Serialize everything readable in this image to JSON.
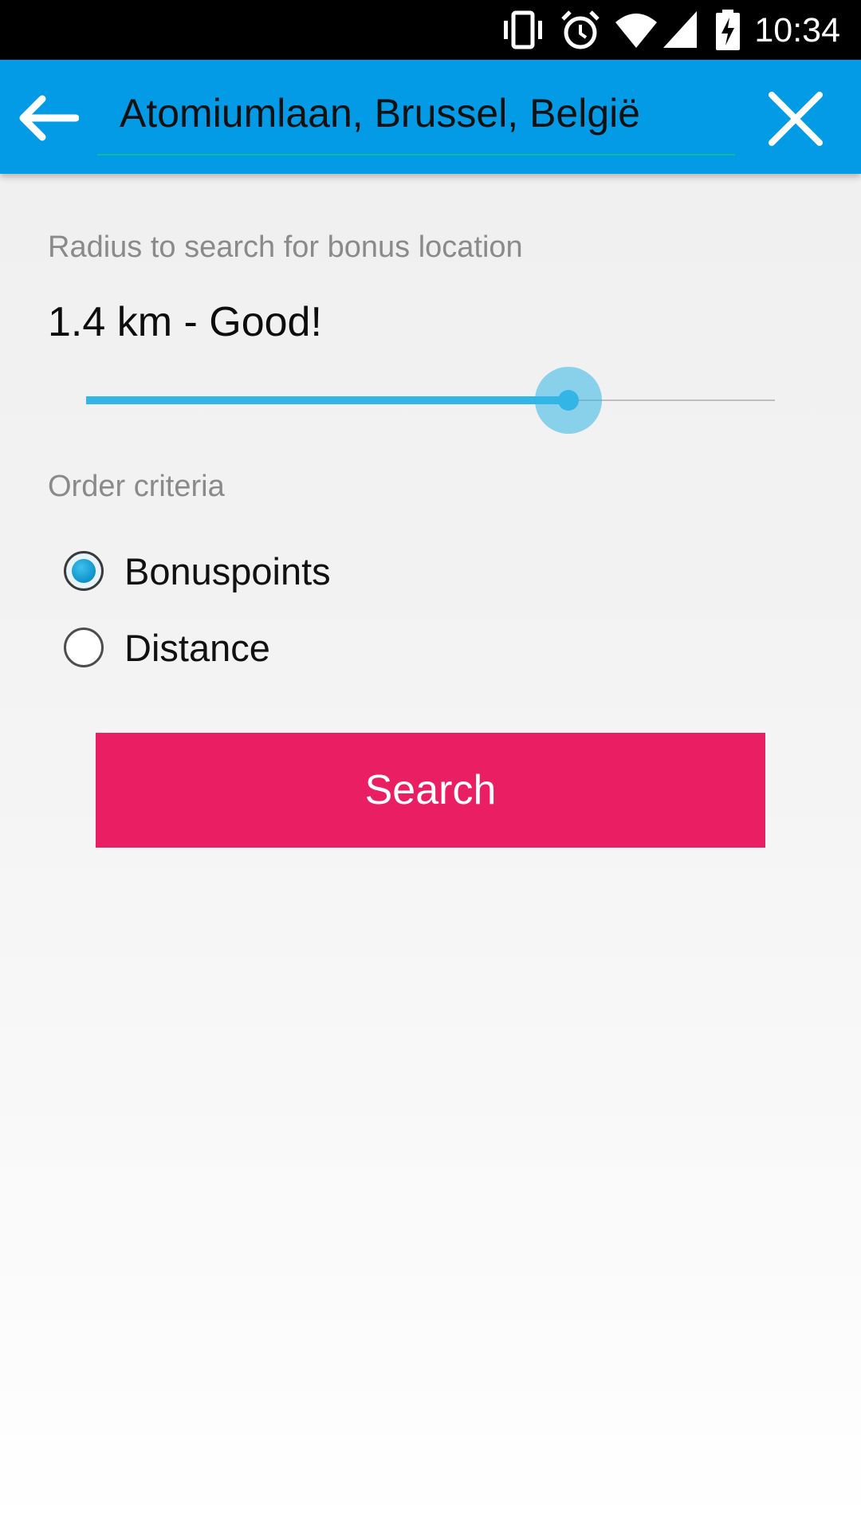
{
  "status_bar": {
    "time": "10:34",
    "icons": [
      "vibrate-icon",
      "alarm-icon",
      "wifi-icon",
      "cell-signal-icon",
      "battery-charging-icon"
    ]
  },
  "toolbar": {
    "back_icon": "arrow-back-icon",
    "query": "Atomiumlaan, Brussel, België",
    "close_icon": "close-icon",
    "color": "#039be5"
  },
  "radius": {
    "label": "Radius to search for bonus location",
    "value_text": "1.4 km - Good!",
    "slider_fraction": 0.7,
    "accent": "#33b5e5"
  },
  "order": {
    "label": "Order criteria",
    "options": [
      {
        "label": "Bonuspoints",
        "checked": true
      },
      {
        "label": "Distance",
        "checked": false
      }
    ]
  },
  "search_button": {
    "label": "Search",
    "color": "#e91e63"
  }
}
